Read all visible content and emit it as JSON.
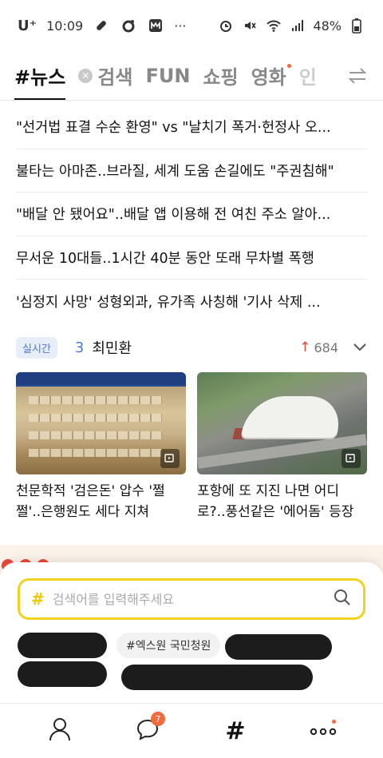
{
  "status_bar": {
    "carrier": "U⁺",
    "time": "10:09",
    "ellipsis": "···",
    "battery": "48%",
    "icons": [
      "pill-icon",
      "circle-dot-icon",
      "messenger-app-icon",
      "alarm-icon",
      "mute-icon",
      "wifi-icon",
      "signal-icon",
      "battery-icon"
    ]
  },
  "tabs": {
    "items": [
      {
        "label": "#뉴스",
        "active": true
      },
      {
        "label": "검색",
        "clear_icon": "close-circle-icon"
      },
      {
        "label": "FUN"
      },
      {
        "label": "쇼핑"
      },
      {
        "label": "영화",
        "has_dot": true
      },
      {
        "label": "인"
      }
    ],
    "swap_icon": "swap-arrows-icon"
  },
  "headlines": [
    "\"선거법 표결 수순 환영\" vs \"날치기 폭거·헌정사 오...",
    "불타는 아마존..브라질, 세계 도움 손길에도 \"주권침해\"",
    "\"배달 안 됐어요\"..배달 앱 이용해 전 여친 주소 알아...",
    "무서운 10대들..1시간 40분 동안 또래 무차별 폭행",
    "'심정지 사망' 성형외과, 유가족 사칭해 '기사 삭제 ..."
  ],
  "realtime": {
    "badge": "실시간",
    "rank": "3",
    "name": "최민환",
    "count": "684",
    "trend_icon": "arrow-up-icon",
    "toggle_icon": "chevron-down-icon"
  },
  "cards": [
    {
      "title": "천문학적 '검은돈' 압수 '쩔쩔'..은행원도 세다 지쳐",
      "play_icon": "video-play-icon"
    },
    {
      "title": "포항에 또 지진 나면 어디로?..풍선같은 '에어돔' 등장",
      "play_icon": "video-play-icon"
    }
  ],
  "search": {
    "hash": "#",
    "placeholder": "검색어를 입력해주세요",
    "search_icon": "search-icon"
  },
  "chips": {
    "visible_chip": "#엑스원 국민청원"
  },
  "nav": {
    "profile_icon": "person-icon",
    "chat_icon": "chat-bubble-icon",
    "chat_badge": "7",
    "hash_label": "#",
    "more_icon": "more-dots-icon"
  },
  "colors": {
    "accent_yellow": "#f2d21f",
    "accent_orange": "#f26a3d",
    "realtime_blue": "#4a7ad2",
    "trend_red": "#e34a3a"
  }
}
